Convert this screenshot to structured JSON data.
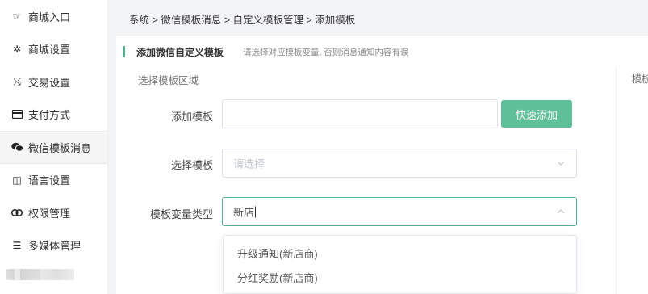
{
  "sidebar": {
    "items": [
      {
        "label": "商城入口",
        "icon": "hand-pointer-icon"
      },
      {
        "label": "商城设置",
        "icon": "gear-icon"
      },
      {
        "label": "交易设置",
        "icon": "exchange-icon"
      },
      {
        "label": "支付方式",
        "icon": "card-icon"
      },
      {
        "label": "微信模板消息",
        "icon": "wechat-icon"
      },
      {
        "label": "语言设置",
        "icon": "language-icon"
      },
      {
        "label": "权限管理",
        "icon": "link-icon"
      },
      {
        "label": "多媒体管理",
        "icon": "list-icon"
      }
    ],
    "active_index": 4
  },
  "breadcrumb": "系统 > 微信模板消息 > 自定义模板管理 > 添加模板",
  "section": {
    "title": "添加微信自定义模板",
    "hint": "请选择对应模板变量, 否则消息通知内容有误"
  },
  "area_label": "选择模板区域",
  "right_label": "模板",
  "form": {
    "add_template_label": "添加模板",
    "add_template_value": "",
    "quick_add_label": "快速添加",
    "select_template_label": "选择模板",
    "select_template_placeholder": "请选择",
    "var_type_label": "模板变量类型",
    "var_type_value": "新店"
  },
  "dropdown_options": [
    "升级通知(新店商)",
    "分红奖励(新店商)"
  ],
  "colors": {
    "accent": "#51b48e",
    "button": "#5fbf98"
  }
}
